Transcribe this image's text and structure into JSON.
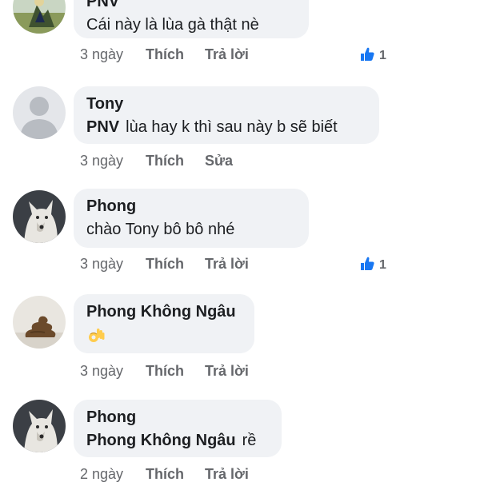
{
  "colors": {
    "bubble_bg": "#f0f2f5",
    "meta_text": "#65676b",
    "like_blue": "#1877f2"
  },
  "comments": [
    {
      "author": "PNV",
      "text": "Cái này là lùa gà thật nè",
      "time": "3 ngày",
      "like_label": "Thích",
      "action_label": "Trả lời",
      "reaction_count": "1",
      "avatar_icon": "landscape-avatar-icon"
    },
    {
      "author": "Tony",
      "mention": "PNV",
      "text": "lùa hay k thì sau này b sẽ biết",
      "time": "3 ngày",
      "like_label": "Thích",
      "action_label": "Sửa",
      "avatar_icon": "default-user-avatar-icon"
    },
    {
      "author": "Phong",
      "text": "chào Tony bô bô nhé",
      "time": "3 ngày",
      "like_label": "Thích",
      "action_label": "Trả lời",
      "reaction_count": "1",
      "avatar_icon": "wolf-avatar-icon"
    },
    {
      "author": "Phong Không Ngâu",
      "emoji_icon": "ok-hand-emoji-icon",
      "time": "3 ngày",
      "like_label": "Thích",
      "action_label": "Trả lời",
      "avatar_icon": "poop-avatar-icon"
    },
    {
      "author": "Phong",
      "mention": "Phong Không Ngâu",
      "text": "rề",
      "time": "2 ngày",
      "like_label": "Thích",
      "action_label": "Trả lời",
      "avatar_icon": "wolf-avatar-icon"
    }
  ]
}
